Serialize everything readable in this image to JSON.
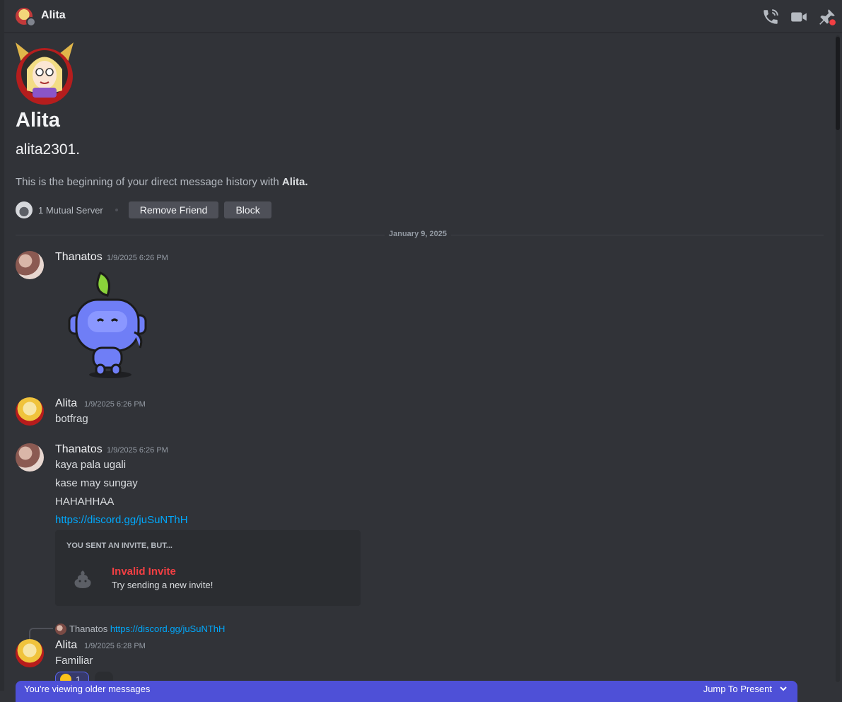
{
  "header": {
    "title": "Alita"
  },
  "intro": {
    "display_name": "Alita",
    "username": "alita2301.",
    "description_prefix": "This is the beginning of your direct message history with ",
    "description_name": "Alita.",
    "mutual_servers": "1 Mutual Server",
    "remove_friend_label": "Remove Friend",
    "block_label": "Block"
  },
  "date_divider": "January 9, 2025",
  "messages": [
    {
      "author": "Thanatos",
      "timestamp": "1/9/2025 6:26 PM"
    },
    {
      "author": "Alita",
      "timestamp": "1/9/2025 6:26 PM",
      "text": "botfrag"
    },
    {
      "author": "Thanatos",
      "timestamp": "1/9/2025 6:26 PM",
      "lines": [
        "kaya pala ugali",
        "kase may sungay",
        "HAHAHHAA"
      ],
      "link": "https://discord.gg/juSuNThH"
    },
    {
      "author": "Alita",
      "timestamp": "1/9/2025 6:28 PM",
      "text": "Familiar",
      "reply_author": "Thanatos",
      "reply_text": "https://discord.gg/juSuNThH",
      "reaction_count": "1"
    }
  ],
  "invite": {
    "title": "YOU SENT AN INVITE, BUT...",
    "name": "Invalid Invite",
    "subtitle": "Try sending a new invite!"
  },
  "older_bar": {
    "text": "You're viewing older messages",
    "jump_label": "Jump To Present"
  },
  "colors": {
    "accent": "#5865f2",
    "link": "#00a8fc",
    "danger": "#f23f43",
    "background": "#313338"
  },
  "icons": [
    "phone-call-icon",
    "video-call-icon",
    "pin-icon",
    "chevron-down-icon",
    "plus-react-icon"
  ]
}
